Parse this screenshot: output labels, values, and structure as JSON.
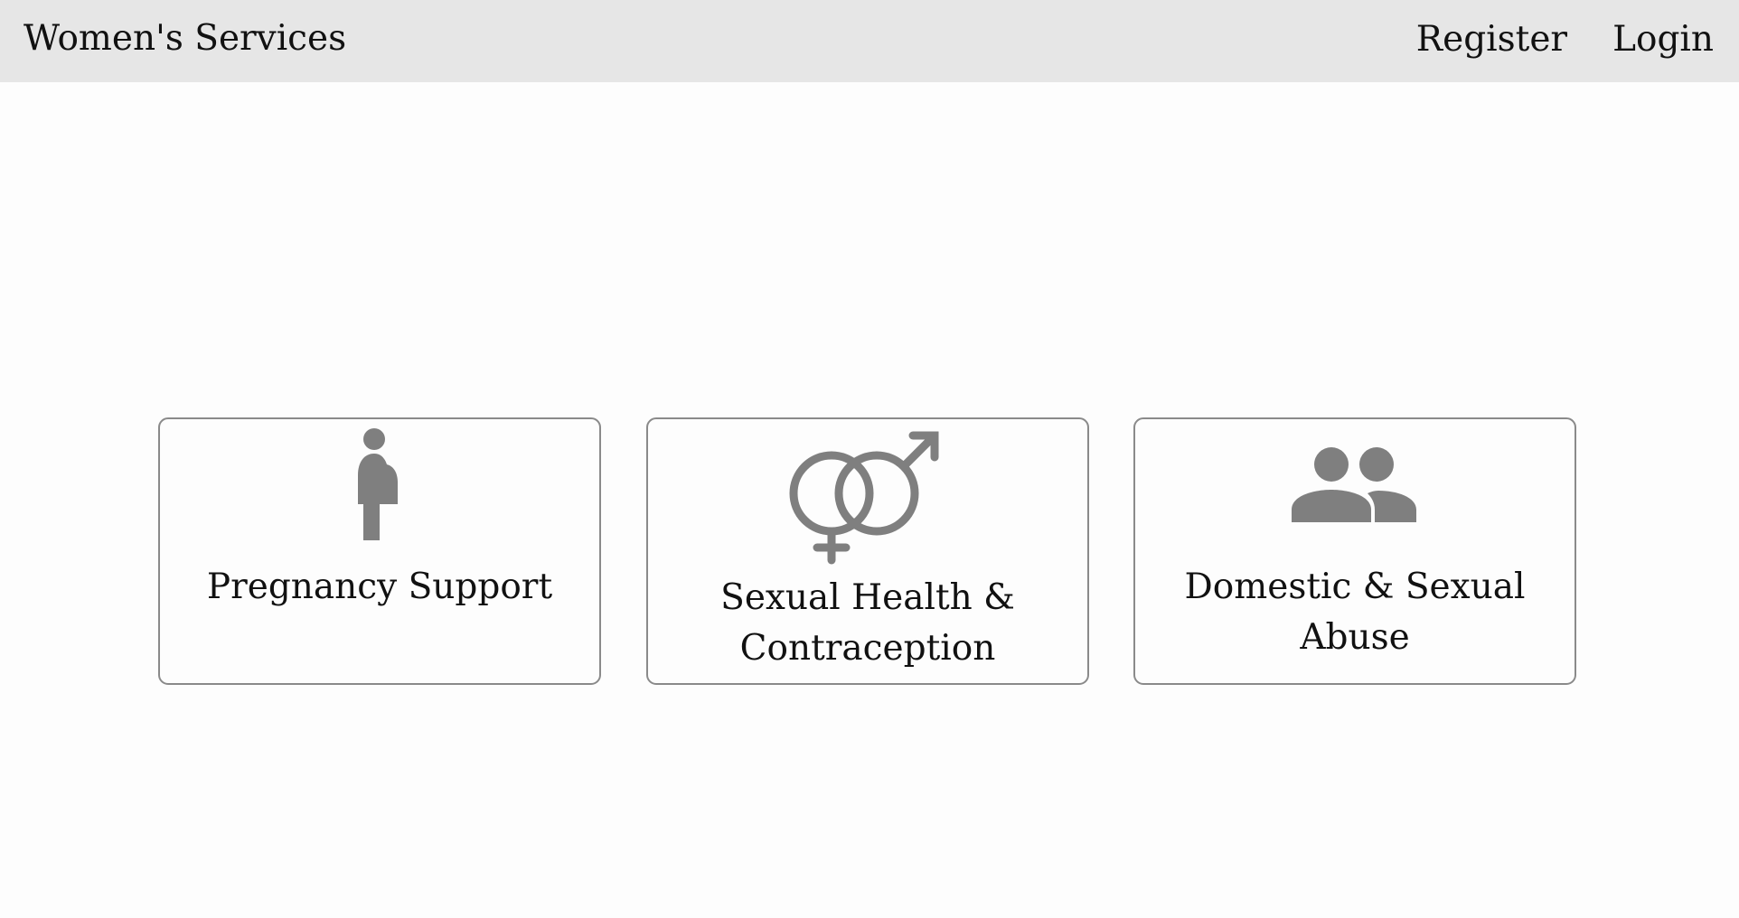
{
  "navbar": {
    "brand": "Women's Services",
    "links": [
      {
        "label": "Register"
      },
      {
        "label": "Login"
      }
    ]
  },
  "cards": [
    {
      "label": "Pregnancy Support",
      "icon": "pregnant-woman-icon"
    },
    {
      "label": "Sexual Health & Contraception",
      "icon": "gender-symbols-icon"
    },
    {
      "label": "Domestic & Sexual Abuse",
      "icon": "people-icon"
    }
  ],
  "colors": {
    "navbar_bg": "#e6e6e6",
    "icon": "#7f7f7f",
    "card_border": "#8a8a8a",
    "text": "#111111"
  }
}
